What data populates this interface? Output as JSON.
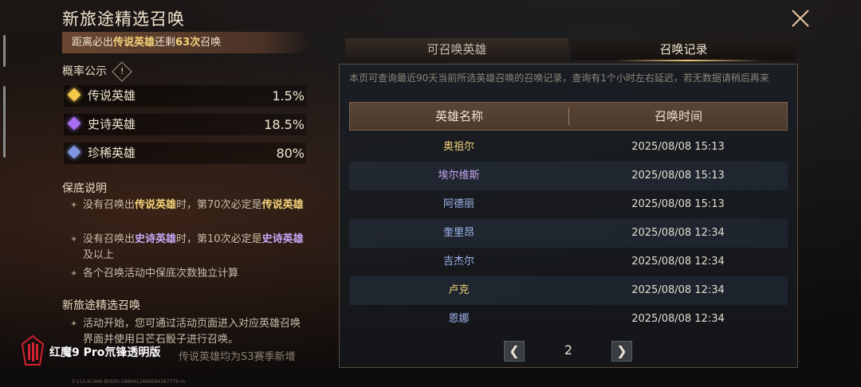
{
  "left": {
    "title": "新旅途精选召唤",
    "pity_prefix": "距离必出",
    "pity_target": "传说英雄",
    "pity_middle": "还剩",
    "pity_count": "63次",
    "pity_suffix": "召唤",
    "rates_title": "概率公示",
    "info_icon": "!",
    "rates": [
      {
        "name": "传说英雄",
        "value": "1.5%",
        "color": "#f4c84a"
      },
      {
        "name": "史诗英雄",
        "value": "18.5%",
        "color": "#a86ef0"
      },
      {
        "name": "珍稀英雄",
        "value": "80%",
        "color": "#7f95e0"
      }
    ],
    "guarantee_title": "保底说明",
    "guarantee_notes": [
      {
        "pre": "没有召唤出",
        "hl": "传说英雄",
        "mid": "时，第70次必定是",
        "hl2": "传说英雄",
        "post": ""
      },
      {
        "pre": "没有召唤出",
        "hl": "史诗英雄",
        "mid": "时，第10次必定是",
        "hl2": "史诗英雄",
        "post": "及以上"
      },
      {
        "text": "各个召唤活动中保底次数独立计算"
      }
    ],
    "event_title": "新旅途精选召唤",
    "event_note": "活动开始，您可通过活动页面进入对应英雄召唤界面并使用日芒石骰子进行召唤。",
    "event_note_cut": "传说英雄均为S3赛季新增"
  },
  "watermark": "红魔9 Pro氘锋透明版",
  "tiny_id": "0.115.61968-85930-18894124685842677​76-m",
  "tabs": [
    {
      "label": "可召唤英雄",
      "active": false
    },
    {
      "label": "召唤记录",
      "active": true
    }
  ],
  "history": {
    "description": "本页可查询最近90天当前所选英雄召唤的召唤记录，查询有1个小时左右延迟，若无数据请稍后再来",
    "col_name": "英雄名称",
    "col_time": "召唤时间",
    "rows": [
      {
        "name": "奥祖尔",
        "time": "2025/08/08 15:13",
        "rarity": "legend"
      },
      {
        "name": "埃尔维斯",
        "time": "2025/08/08 15:13",
        "rarity": "epic"
      },
      {
        "name": "阿德丽",
        "time": "2025/08/08 15:13",
        "rarity": "rare"
      },
      {
        "name": "奎里昂",
        "time": "2025/08/08 12:34",
        "rarity": "rare"
      },
      {
        "name": "吉杰尔",
        "time": "2025/08/08 12:34",
        "rarity": "rare"
      },
      {
        "name": "卢克",
        "time": "2025/08/08 12:34",
        "rarity": "legend"
      },
      {
        "name": "恩娜",
        "time": "2025/08/08 12:34",
        "rarity": "rare"
      }
    ],
    "page": "2",
    "prev_icon": "chevron-left",
    "next_icon": "chevron-right"
  }
}
